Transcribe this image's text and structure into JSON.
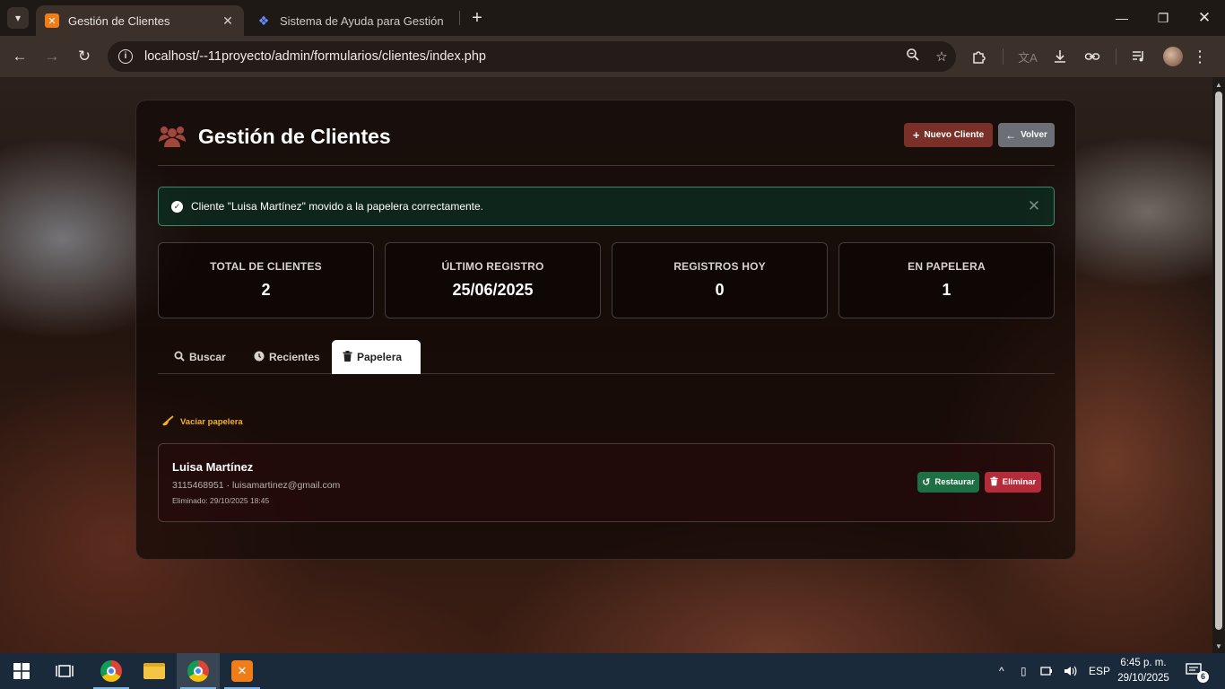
{
  "browser": {
    "tabs": [
      {
        "title": "Gestión de Clientes",
        "favicon": "xampp-icon",
        "active": true
      },
      {
        "title": "Sistema de Ayuda para Gestión",
        "favicon": "app-icon",
        "active": false
      }
    ],
    "url": "localhost/--11proyecto/admin/formularios/clientes/index.php"
  },
  "page": {
    "title": "Gestión de Clientes",
    "actions": {
      "new_client": "Nuevo Cliente",
      "back": "Volver"
    },
    "alert": {
      "message": "Cliente \"Luisa Martínez\" movido a la papelera correctamente."
    },
    "stats": [
      {
        "label": "TOTAL DE CLIENTES",
        "value": "2"
      },
      {
        "label": "ÚLTIMO REGISTRO",
        "value": "25/06/2025"
      },
      {
        "label": "REGISTROS HOY",
        "value": "0"
      },
      {
        "label": "EN PAPELERA",
        "value": "1"
      }
    ],
    "tabs": [
      {
        "label": "Buscar",
        "icon": "search-icon"
      },
      {
        "label": "Recientes",
        "icon": "clock-icon"
      },
      {
        "label": "Papelera",
        "icon": "trash-icon",
        "active": true
      }
    ],
    "trash": {
      "empty_label": "Vaciar papelera",
      "items": [
        {
          "name": "Luisa Martínez",
          "contact": "3115468951 · luisamartinez@gmail.com",
          "deleted": "Eliminado: 29/10/2025 18:45",
          "restore_label": "Restaurar",
          "delete_label": "Eliminar"
        }
      ]
    }
  },
  "taskbar": {
    "language": "ESP",
    "time": "6:45 p. m.",
    "date": "29/10/2025",
    "notifications": "6"
  },
  "colors": {
    "accent_red": "#7a3028",
    "success_green": "#1e6f44",
    "danger_red": "#b42c3a",
    "warning_yellow": "#f0b429"
  }
}
